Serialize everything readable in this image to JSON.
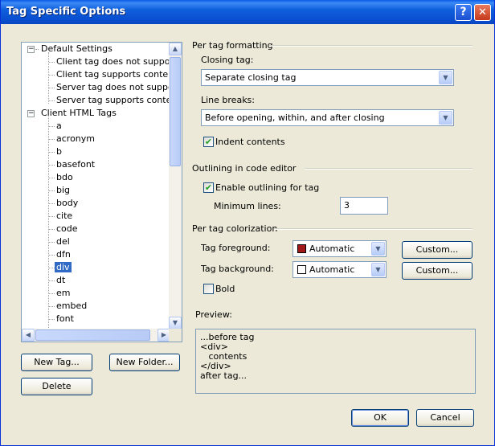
{
  "window": {
    "title": "Tag Specific Options",
    "help_glyph": "?",
    "close_glyph": "✕"
  },
  "tree": {
    "default_settings": {
      "label": "Default Settings",
      "expander": "−",
      "children": [
        "Client tag does not support c",
        "Client tag supports contents",
        "Server tag does not support",
        "Server tag supports contents"
      ]
    },
    "client_html_tags": {
      "label": "Client HTML Tags",
      "expander": "−",
      "children": [
        "a",
        "acronym",
        "b",
        "basefont",
        "bdo",
        "big",
        "body",
        "cite",
        "code",
        "del",
        "dfn",
        "div",
        "dt",
        "em",
        "embed",
        "font"
      ],
      "selected": "div"
    }
  },
  "buttons": {
    "new_tag": "New Tag...",
    "new_folder": "New Folder...",
    "delete": "Delete",
    "ok": "OK",
    "cancel": "Cancel",
    "custom_fg": "Custom...",
    "custom_bg": "Custom..."
  },
  "formatting": {
    "heading": "Per tag formatting",
    "closing_tag_label": "Closing tag:",
    "closing_tag_value": "Separate closing tag",
    "line_breaks_label": "Line breaks:",
    "line_breaks_value": "Before opening, within, and after closing",
    "indent_label": "Indent contents",
    "indent_checked": true
  },
  "outlining": {
    "heading": "Outlining in code editor",
    "enable_label": "Enable outlining for tag",
    "enable_checked": true,
    "min_lines_label": "Minimum lines:",
    "min_lines_value": "3"
  },
  "colorization": {
    "heading": "Per tag colorization",
    "fg_label": "Tag foreground:",
    "fg_value": "Automatic",
    "fg_color": "#a01818",
    "bg_label": "Tag background:",
    "bg_value": "Automatic",
    "bg_color": "#ffffff",
    "bold_label": "Bold",
    "bold_checked": false
  },
  "preview": {
    "label": "Preview:",
    "lines": [
      "...before tag",
      "<div>",
      "   contents",
      "</div>",
      "after tag..."
    ]
  },
  "icons": {
    "scroll_up": "▲",
    "scroll_down": "▼",
    "scroll_left": "◀",
    "scroll_right": "▶",
    "combo_arrow": "▼",
    "check_mark": "✔"
  }
}
